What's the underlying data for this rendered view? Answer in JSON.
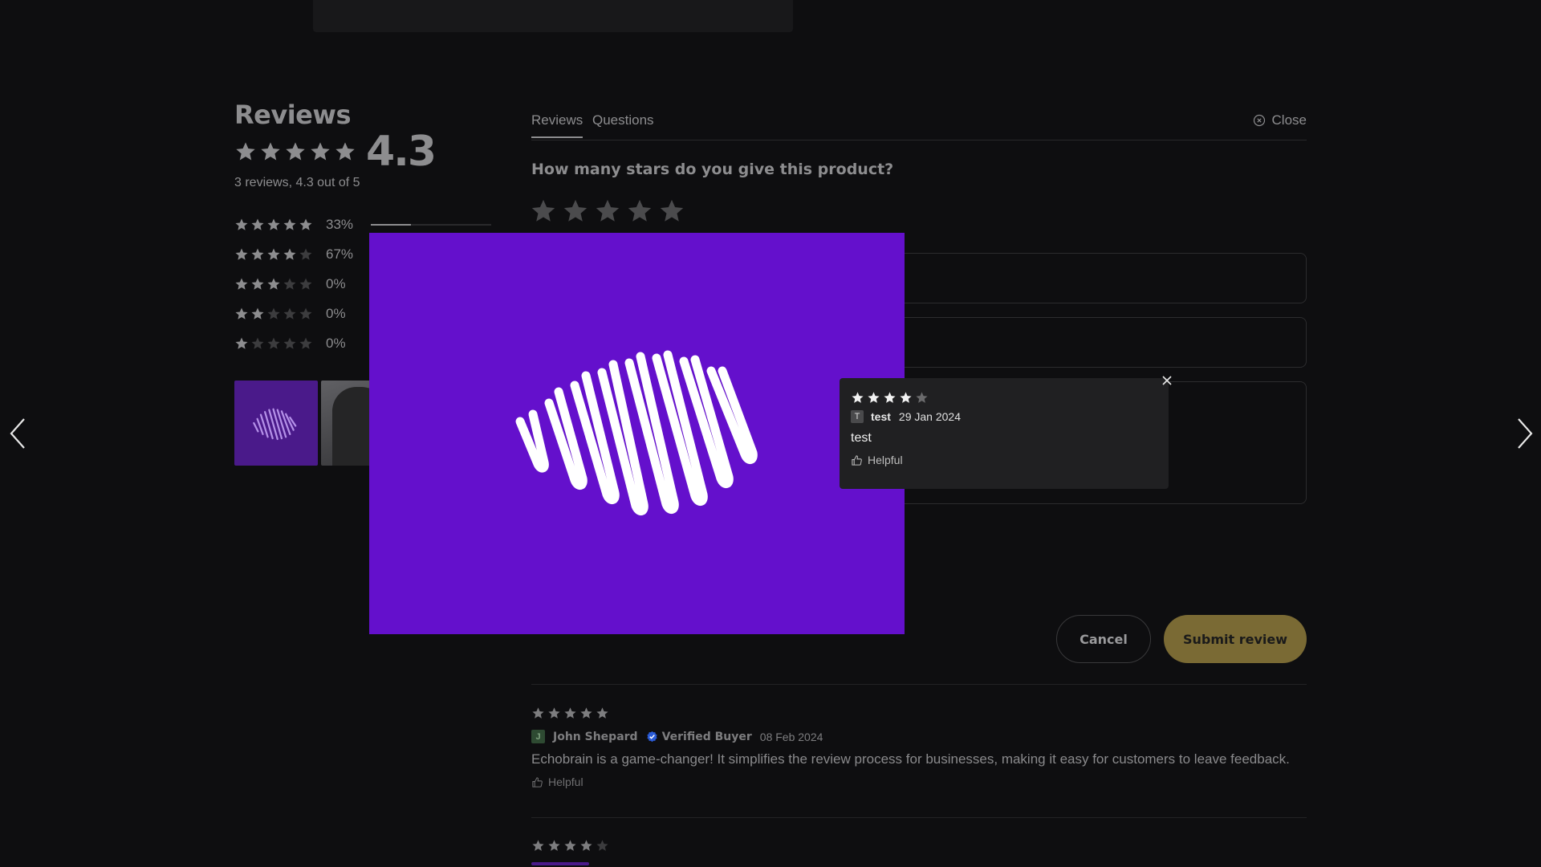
{
  "summary": {
    "title": "Reviews",
    "score": "4.3",
    "stars_filled": 5,
    "subtitle": "3 reviews, 4.3 out of 5",
    "distribution": [
      {
        "stars": 5,
        "pct_label": "33%",
        "fraction": 0.33
      },
      {
        "stars": 4,
        "pct_label": "67%",
        "fraction": 0.67
      },
      {
        "stars": 3,
        "pct_label": "0%",
        "fraction": 0
      },
      {
        "stars": 2,
        "pct_label": "0%",
        "fraction": 0
      },
      {
        "stars": 1,
        "pct_label": "0%",
        "fraction": 0
      }
    ]
  },
  "tabs": [
    {
      "label": "Reviews",
      "active": true
    },
    {
      "label": "Questions",
      "active": false
    }
  ],
  "close_label": "Close",
  "form": {
    "question": "How many stars do you give this product?",
    "rating": 0,
    "cancel_label": "Cancel",
    "submit_label": "Submit review"
  },
  "reviews": [
    {
      "stars": 5,
      "avatar_letter": "J",
      "name": "John Shepard",
      "verified_label": "Verified Buyer",
      "date": "08 Feb 2024",
      "text": "Echobrain is a game-changer! It simplifies the review process for businesses, making it easy for customers to leave feedback.",
      "helpful_label": "Helpful"
    },
    {
      "stars": 4
    }
  ],
  "popup": {
    "stars": 4,
    "avatar_letter": "T",
    "name": "test",
    "date": "29 Jan 2024",
    "text": "test",
    "helpful_label": "Helpful"
  },
  "colors": {
    "background": "#0e0e10",
    "modal_image": "#6410cc",
    "submit": "#7a6a34",
    "verified": "#2a5bd7"
  },
  "icons": [
    "star-icon",
    "close-circle-icon",
    "thumbs-up-icon",
    "verified-icon",
    "close-icon",
    "chevron-left-icon",
    "chevron-right-icon"
  ]
}
